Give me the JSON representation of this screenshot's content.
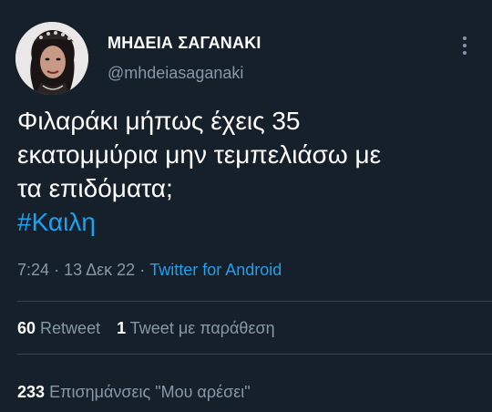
{
  "tweet": {
    "author": {
      "display_name": "ΜΗΔΕΙΑ ΣΑΓΑΝΑΚΙ",
      "handle": "@mhdeiasaganaki",
      "avatar_icon": "profile-photo"
    },
    "more_icon": "vertical-ellipsis-icon",
    "text_lines": [
      "Φιλαράκι μήπως έχεις 35",
      "εκατομμύρια μην τεμπελιάσω με",
      "τα επιδόματα;"
    ],
    "hashtag": "#Καιλη",
    "time": "7:24",
    "date": "13 Δεκ 22",
    "separator": "·",
    "source": "Twitter for Android",
    "retweets": {
      "count": "60",
      "label": "Retweet"
    },
    "quotes": {
      "count": "1",
      "label": "Tweet με παράθεση"
    },
    "likes": {
      "count": "233",
      "label": "Επισημάνσεις \"Μου αρέσει\""
    }
  },
  "colors": {
    "background": "#15202b",
    "text_primary": "#ffffff",
    "text_secondary": "#8899a6",
    "accent": "#1da1f2",
    "divider": "#38444d"
  }
}
